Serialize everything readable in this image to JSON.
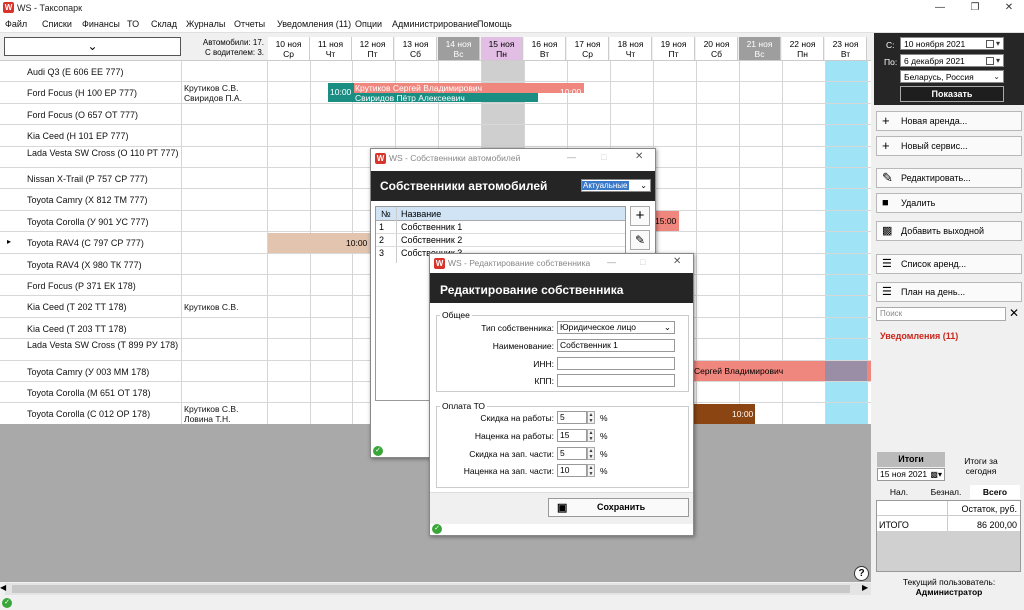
{
  "window": {
    "app_icon": "W",
    "title": "WS - Таксопарк",
    "minimize": "—",
    "maximize": "❐",
    "close": "✕"
  },
  "menu": [
    "Файл",
    "Списки",
    "Финансы",
    "ТО",
    "Склад",
    "Журналы",
    "Отчеты",
    "Уведомления (11)",
    "Опции",
    "Администрирование",
    "Помощь"
  ],
  "summary": {
    "cars": "Автомобили: 17.",
    "with_driver": "С водителем: 3."
  },
  "days": [
    {
      "date": "10 ноя",
      "dow": "Ср"
    },
    {
      "date": "11 ноя",
      "dow": "Чт"
    },
    {
      "date": "12 ноя",
      "dow": "Пт"
    },
    {
      "date": "13 ноя",
      "dow": "Сб"
    },
    {
      "date": "14 ноя",
      "dow": "Вс"
    },
    {
      "date": "15 ноя",
      "dow": "Пн"
    },
    {
      "date": "16 ноя",
      "dow": "Вт"
    },
    {
      "date": "17 ноя",
      "dow": "Ср"
    },
    {
      "date": "18 ноя",
      "dow": "Чт"
    },
    {
      "date": "19 ноя",
      "dow": "Пт"
    },
    {
      "date": "20 ноя",
      "dow": "Сб"
    },
    {
      "date": "21 ноя",
      "dow": "Вс"
    },
    {
      "date": "22 ноя",
      "dow": "Пн"
    },
    {
      "date": "23 ноя",
      "dow": "Вт"
    }
  ],
  "cars": [
    {
      "name": "Audi Q3 (Е 606 ЕЕ 777)",
      "driver": ""
    },
    {
      "name": "Ford Focus (Н 100 ЕР 777)",
      "driver": "Крутиков С.В.\nСвиридов П.А."
    },
    {
      "name": "Ford Focus (О 657 ОТ 777)",
      "driver": ""
    },
    {
      "name": "Kia Ceed (Н 101 ЕР 777)",
      "driver": ""
    },
    {
      "name": "Lada Vesta SW Cross (О 110 РТ 777)",
      "driver": ""
    },
    {
      "name": "Nissan X-Trail (Р 757 СР 777)",
      "driver": ""
    },
    {
      "name": "Toyota Camry (Х 812 ТМ 777)",
      "driver": ""
    },
    {
      "name": "Toyota Corolla (У 901 УС 777)",
      "driver": ""
    },
    {
      "name": "Toyota RAV4 (С 797 СР 777)",
      "driver": ""
    },
    {
      "name": "Toyota RAV4 (Х 980 ТК 777)",
      "driver": ""
    },
    {
      "name": "Ford Focus (Р 371 ЕК 178)",
      "driver": ""
    },
    {
      "name": "Kia Ceed (Т 202 ТТ 178)",
      "driver": "Крутиков С.В."
    },
    {
      "name": "Kia Ceed (Т 203 ТТ 178)",
      "driver": ""
    },
    {
      "name": "Lada Vesta SW Cross (Т 899 РУ 178)",
      "driver": ""
    },
    {
      "name": "Toyota Camry (У 003 ММ 178)",
      "driver": ""
    },
    {
      "name": "Toyota Corolla (М 651 ОТ 178)",
      "driver": ""
    },
    {
      "name": "Toyota Corolla (С 012 ОР 178)",
      "driver": "Крутиков С.В.\nЛовина Т.Н."
    }
  ],
  "bars": {
    "ford_time1": "10:00",
    "ford_names": "Крутиков Сергей Владимирович\nСвиридов Пётр Алексеевич",
    "ford_time2": "10:00",
    "corolla_time": "15:00",
    "rav4_time": "10:00",
    "camry_name": "Сергей Владимирович",
    "corolla2_time": "10:00"
  },
  "panel": {
    "from_label": "С:",
    "from_date": "10  ноября  2021",
    "to_label": "По:",
    "to_date": "6  декабря  2021",
    "region": "Беларусь, Россия",
    "show": "Показать",
    "new_rent": "Новая аренда...",
    "new_service": "Новый сервис...",
    "edit": "Редактировать...",
    "delete": "Удалить",
    "add_dayoff": "Добавить выходной",
    "rent_list": "Список аренд...",
    "day_plan": "План на день...",
    "search_placeholder": "Поиск",
    "notifications": "Уведомления (11)",
    "totals": "Итоги",
    "totals_today": "Итоги за сегодня",
    "totals_date": "15  ноя  2021",
    "tab_cash": "Нал.",
    "tab_noncash": "Безнал.",
    "tab_all": "Всего",
    "col_balance": "Остаток, руб.",
    "row_total": "ИТОГО",
    "row_total_val": "86 200,00",
    "user_label": "Текущий пользователь:",
    "user_name": "Администратор",
    "help": "?"
  },
  "owners_dialog": {
    "title": "WS - Собственники автомобилей",
    "heading": "Собственники автомобилей",
    "filter": "Актуальные",
    "col_num": "№",
    "col_name": "Название",
    "rows": [
      {
        "n": "1",
        "name": "Собственник 1"
      },
      {
        "n": "2",
        "name": "Собственник 2"
      },
      {
        "n": "3",
        "name": "Собственник 3"
      }
    ]
  },
  "edit_dialog": {
    "title": "WS - Редактирование собственника",
    "heading": "Редактирование собственника",
    "group_general": "Общее",
    "type_label": "Тип собственника:",
    "type_value": "Юридическое лицо",
    "name_label": "Наименование:",
    "name_value": "Собственник 1",
    "inn_label": "ИНН:",
    "kpp_label": "КПП:",
    "group_to": "Оплата ТО",
    "discount_work_label": "Скидка на работы:",
    "discount_work": "5",
    "markup_work_label": "Наценка на работы:",
    "markup_work": "15",
    "discount_parts_label": "Скидка на зап. части:",
    "discount_parts": "5",
    "markup_parts_label": "Наценка на зап. части:",
    "markup_parts": "10",
    "percent": "%",
    "save": "Сохранить"
  },
  "colors": {
    "teal": "#1b8e84",
    "salmon": "#f0877e",
    "tan": "#e3c4ae",
    "brown": "#8b4513",
    "cyan": "#9fe3f6",
    "alert": "#c9261b"
  }
}
